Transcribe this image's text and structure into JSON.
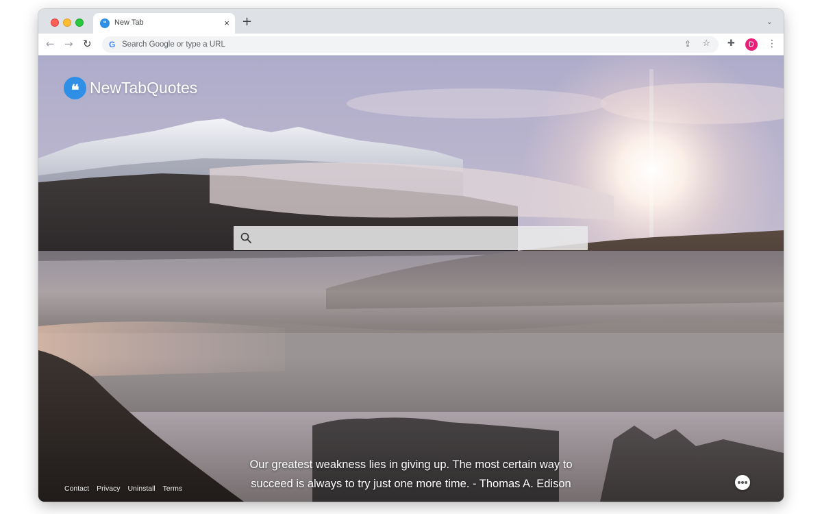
{
  "browser": {
    "tab": {
      "title": "New Tab",
      "favicon_text": "❝",
      "close_glyph": "×"
    },
    "new_tab_glyph": "+",
    "tab_search_glyph": "⌄",
    "omnibox": {
      "g_glyph": "G",
      "placeholder": "Search Google or type a URL"
    },
    "profile_initial": "D",
    "icons": [
      "back-icon",
      "forward-icon",
      "reload-icon",
      "share-icon",
      "bookmark-star-icon",
      "extensions-puzzle-icon",
      "kebab-menu-icon"
    ]
  },
  "page": {
    "brand": {
      "logo_glyph": "❝",
      "name": "NewTabQuotes"
    },
    "search": {
      "placeholder": ""
    },
    "quote": {
      "line1": "Our greatest weakness lies in giving up. The most certain way to",
      "line2": "succeed is always to try just one more time. - Thomas A. Edison"
    },
    "footer_links": [
      "Contact",
      "Privacy",
      "Uninstall",
      "Terms"
    ],
    "colors": {
      "brand_blue": "#2f8fe6",
      "profile_pink": "#e8207a"
    }
  }
}
